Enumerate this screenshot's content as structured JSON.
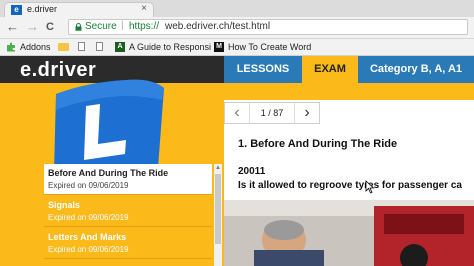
{
  "browser": {
    "tab_title": "e.driver",
    "tab_favicon_letter": "e",
    "tab_close": "×",
    "back": "←",
    "forward": "→",
    "reload": "C",
    "secure_label": "Secure",
    "url_separator": "|",
    "url_scheme": "https://",
    "url_rest": "web.edriver.ch/test.html",
    "bookmarks": {
      "apps": "Addons",
      "item_guide": "A Guide to Responsi",
      "item_howto": "How To Create Word",
      "guide_favicon_letter": "A",
      "howto_favicon_letter": "M"
    }
  },
  "site": {
    "logo": "e.driver",
    "nav": {
      "lessons": "LESSONS",
      "exam": "EXAM",
      "category": "Category B, A, A1"
    },
    "flag_letter": "L",
    "colors": {
      "page_bg": "#fbb91a",
      "header_bg": "#2b2b2b",
      "nav_blue": "#2a7ab8",
      "flag_blue": "#1d6fd1"
    }
  },
  "sidebar": {
    "items": [
      {
        "name": "Before And During The Ride",
        "expired": "Expired on 09/06/2019",
        "active": true
      },
      {
        "name": "Signals",
        "expired": "Expired on 09/06/2019",
        "active": false
      },
      {
        "name": "Letters And Marks",
        "expired": "Expired on 09/06/2019",
        "active": false
      }
    ]
  },
  "question": {
    "pager_prev": "‹",
    "pager_next": "›",
    "pager_count": "1 / 87",
    "section_title": "1. Before And During The Ride",
    "number": "20011",
    "text": "Is it allowed to regroove tyres for passenger ca"
  }
}
